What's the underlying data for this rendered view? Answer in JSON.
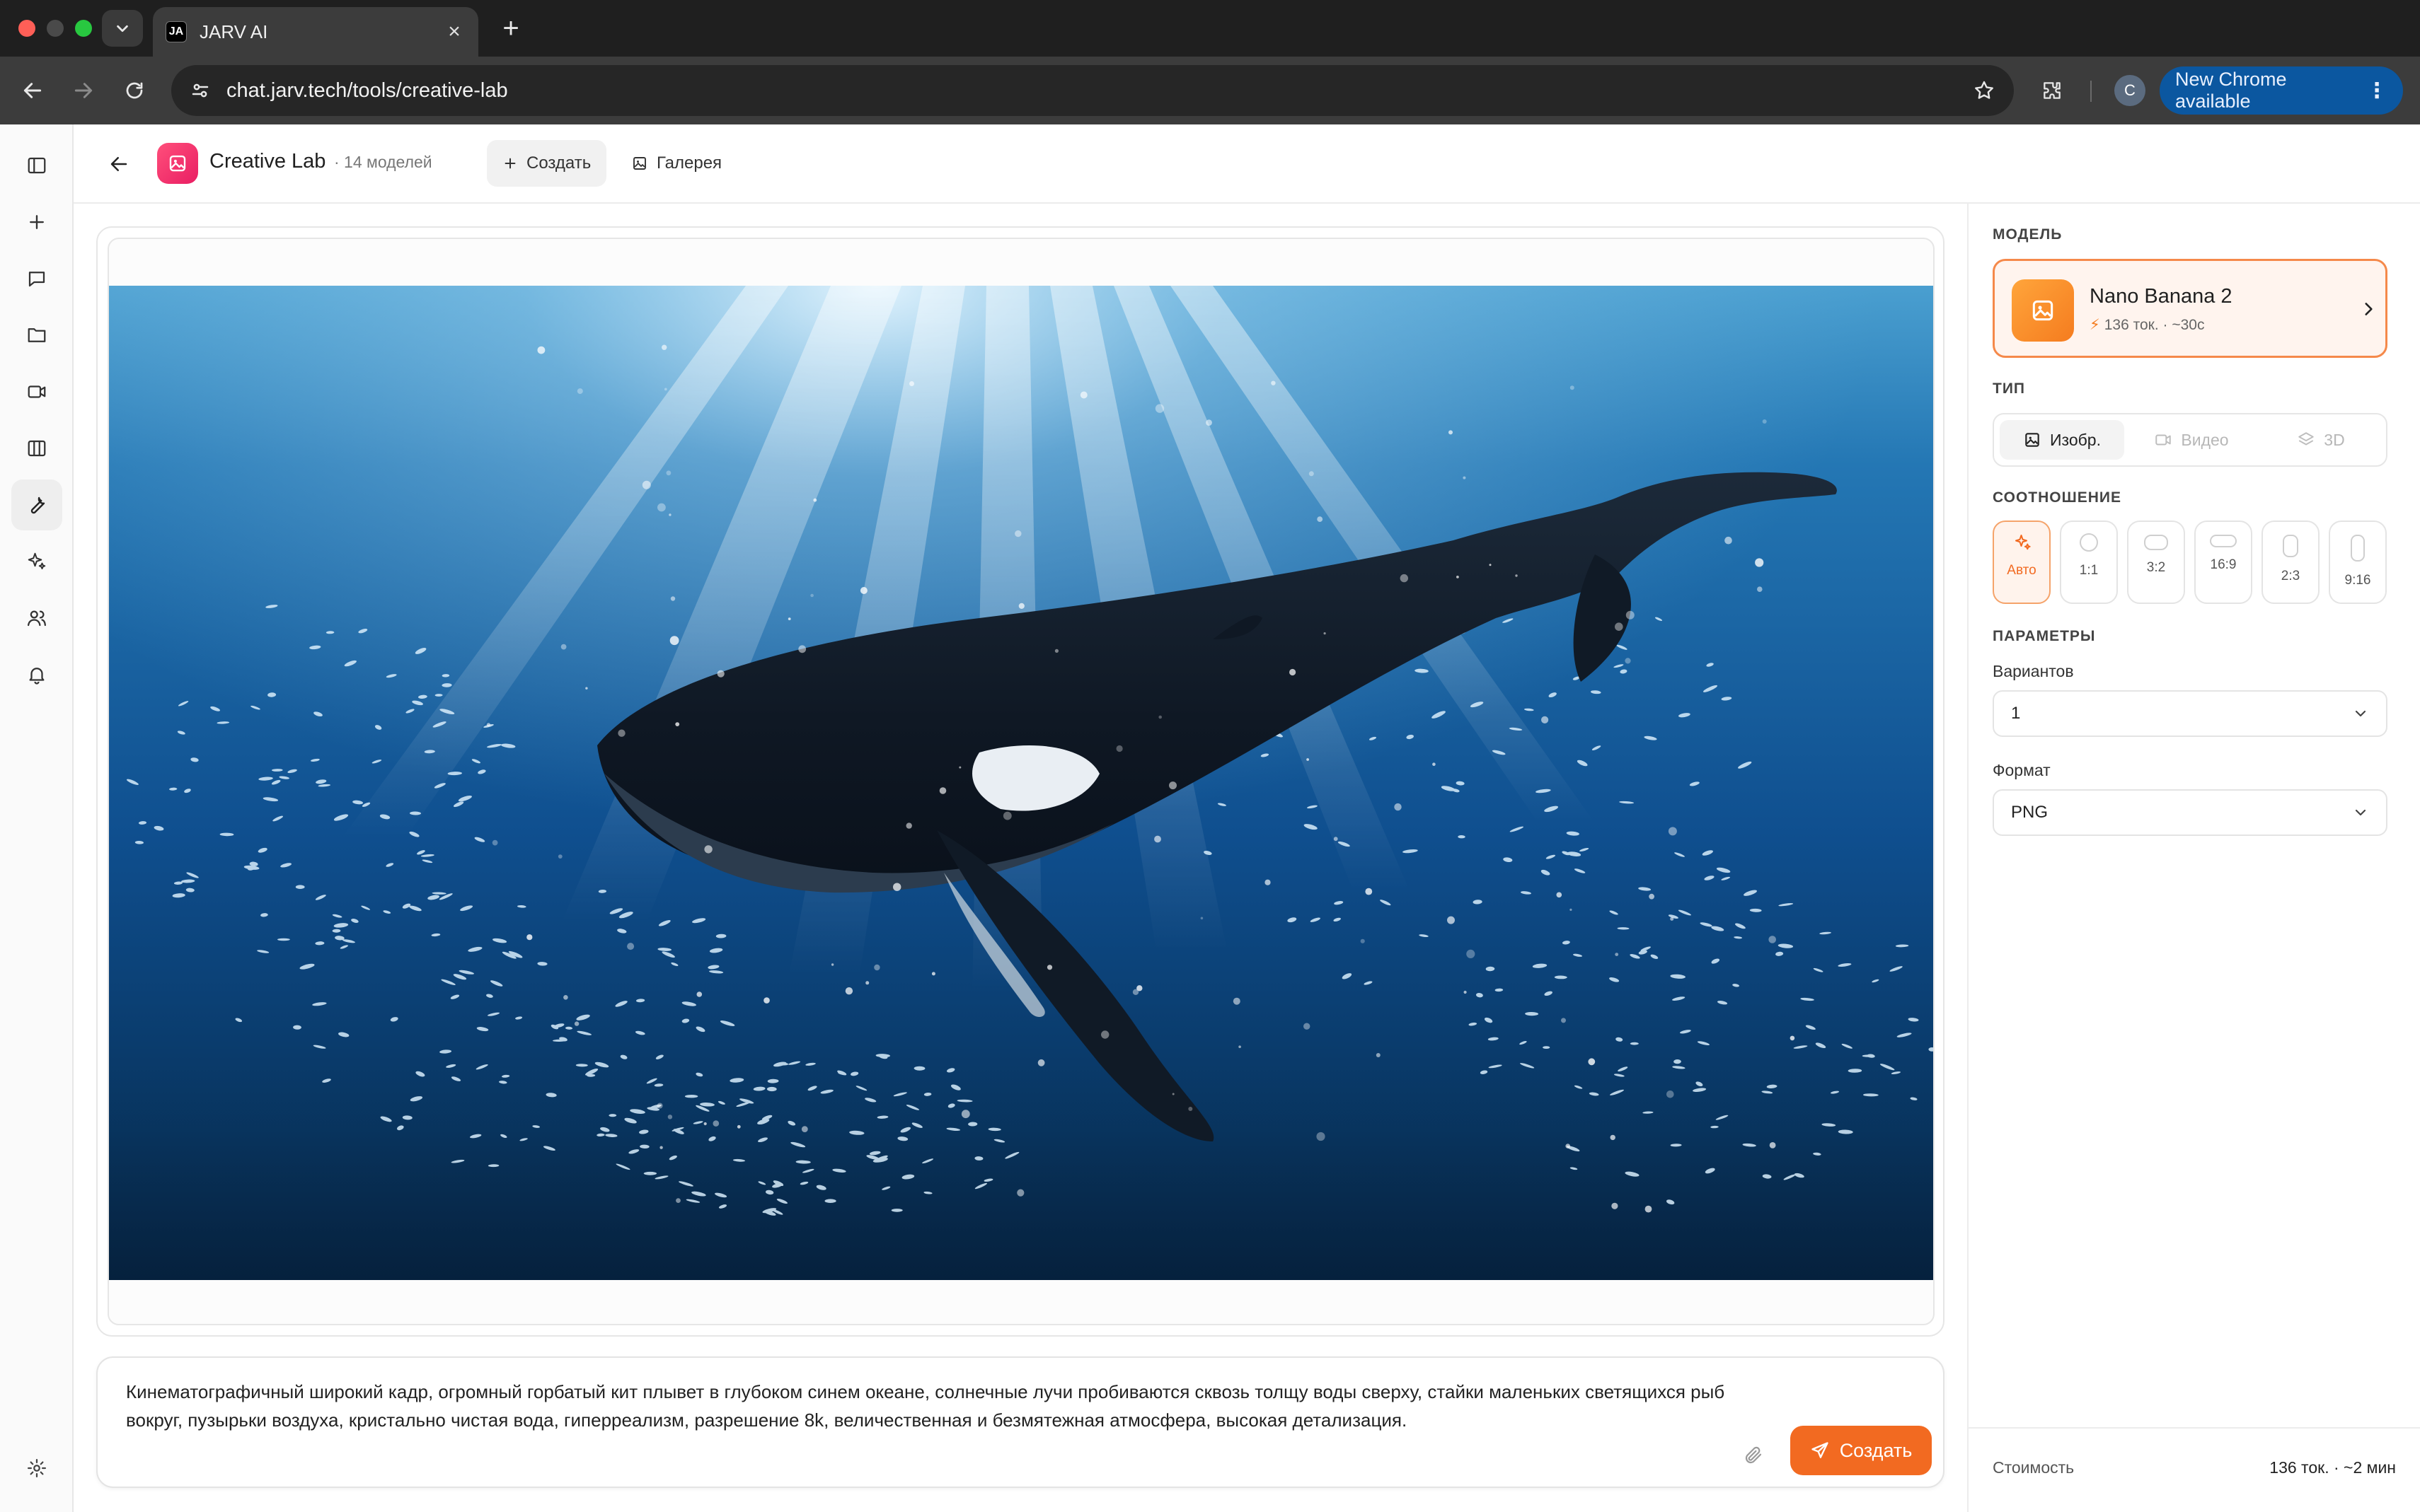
{
  "browser": {
    "tab_title": "JARV AI",
    "favicon_text": "JA",
    "url": "chat.jarv.tech/tools/creative-lab",
    "profile_initial": "C",
    "update_label": "New Chrome available"
  },
  "header": {
    "app_name": "Creative Lab",
    "model_count": "· 14 моделей",
    "tabs": [
      {
        "label": "Создать",
        "active": true
      },
      {
        "label": "Галерея",
        "active": false
      }
    ]
  },
  "sidebar": {
    "items": [
      {
        "icon": "sidebar-toggle-icon"
      },
      {
        "icon": "plus-icon"
      },
      {
        "icon": "chat-icon"
      },
      {
        "icon": "folder-icon"
      },
      {
        "icon": "video-icon"
      },
      {
        "icon": "columns-icon"
      },
      {
        "icon": "wrench-icon",
        "active": true
      },
      {
        "icon": "sparkle-icon"
      },
      {
        "icon": "users-icon"
      },
      {
        "icon": "bell-icon"
      },
      {
        "icon": "settings-icon"
      }
    ]
  },
  "prompt": {
    "text": "Кинематографичный широкий кадр, огромный горбатый кит плывет в глубоком синем океане, солнечные лучи пробиваются сквозь толщу воды сверху, стайки маленьких светящихся рыб вокруг, пузырьки воздуха, кристально чистая вода, гиперреализм, разрешение 8k, величественная и безмятежная атмосфера, высокая детализация.",
    "submit_label": "Создать"
  },
  "panel": {
    "model_section": "МОДЕЛЬ",
    "model": {
      "name": "Nano Banana 2",
      "meta": "136 ток. · ~30с"
    },
    "type_section": "ТИП",
    "types": [
      {
        "label": "Изобр.",
        "active": true
      },
      {
        "label": "Видео",
        "active": false
      },
      {
        "label": "3D",
        "active": false
      }
    ],
    "ratio_section": "СООТНОШЕНИЕ",
    "ratios": [
      {
        "label": "Авто",
        "active": true
      },
      {
        "label": "1:1",
        "active": false
      },
      {
        "label": "3:2",
        "active": false
      },
      {
        "label": "16:9",
        "active": false
      },
      {
        "label": "2:3",
        "active": false
      },
      {
        "label": "9:16",
        "active": false
      }
    ],
    "params_section": "ПАРАМЕТРЫ",
    "variants_label": "Вариантов",
    "variants_value": "1",
    "format_label": "Формат",
    "format_value": "PNG",
    "cost_label": "Стоимость",
    "cost_value": "136 ток. · ~2 мин"
  },
  "colors": {
    "accent": "#f26a21",
    "accent_soft": "#fff4ee",
    "update_pill": "#0b57a0"
  }
}
